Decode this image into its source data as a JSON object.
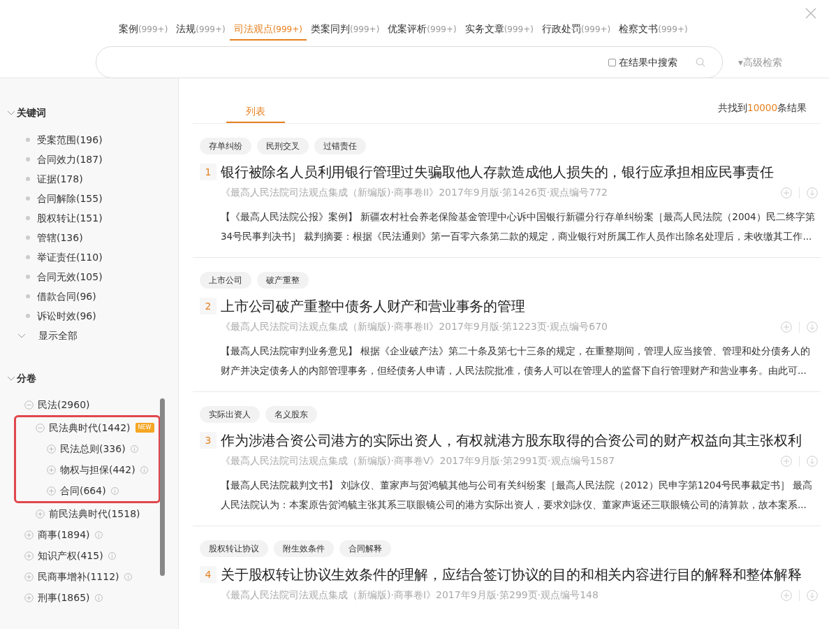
{
  "tabs": [
    {
      "label": "案例",
      "count": "(999+)",
      "selected": false
    },
    {
      "label": "法规",
      "count": "(999+)",
      "selected": false
    },
    {
      "label": "司法观点",
      "count": "(999+)",
      "selected": true
    },
    {
      "label": "类案同判",
      "count": "(999+)",
      "selected": false
    },
    {
      "label": "优案评析",
      "count": "(999+)",
      "selected": false
    },
    {
      "label": "实务文章",
      "count": "(999+)",
      "selected": false
    },
    {
      "label": "行政处罚",
      "count": "(999+)",
      "selected": false
    },
    {
      "label": "检察文书",
      "count": "(999+)",
      "selected": false
    }
  ],
  "search": {
    "in_results_label": "在结果中搜索",
    "in_results_checked": false,
    "advanced": "▾高级检索"
  },
  "sidebar": {
    "keywords": {
      "title": "关键词",
      "expanded": true,
      "items": [
        "受案范围(196)",
        "合同效力(187)",
        "证据(178)",
        "合同解除(155)",
        "股权转让(151)",
        "管辖(136)",
        "举证责任(110)",
        "合同无效(105)",
        "借款合同(96)",
        "诉讼时效(96)"
      ],
      "show_all": "显示全部"
    },
    "volumes": {
      "title": "分卷",
      "expanded": true,
      "tree": [
        {
          "label": "民法(2960)",
          "expanded": true,
          "info": false,
          "highlighted": false,
          "children": [
            {
              "label": "民法典时代(1442)",
              "expanded": true,
              "info": false,
              "badge": "NEW",
              "highlighted": true,
              "children": [
                {
                  "label": "民法总则(336)",
                  "expanded": false,
                  "info": true,
                  "highlighted": false
                },
                {
                  "label": "物权与担保(442)",
                  "expanded": false,
                  "info": true,
                  "highlighted": false
                },
                {
                  "label": "合同(664)",
                  "expanded": false,
                  "info": true,
                  "highlighted": false
                }
              ]
            },
            {
              "label": "前民法典时代(1518)",
              "expanded": false,
              "info": false,
              "highlighted": false
            }
          ]
        },
        {
          "label": "商事(1894)",
          "expanded": false,
          "info": true,
          "highlighted": false
        },
        {
          "label": "知识产权(415)",
          "expanded": false,
          "info": true,
          "highlighted": false
        },
        {
          "label": "民商事增补(1112)",
          "expanded": false,
          "info": true,
          "highlighted": false
        },
        {
          "label": "刑事(1865)",
          "expanded": false,
          "info": true,
          "highlighted": false
        }
      ]
    }
  },
  "view_tabs": [
    {
      "label": "列表",
      "selected": true
    }
  ],
  "result_count": {
    "prefix": "共找到",
    "count": "10000",
    "suffix": "条结果"
  },
  "results": [
    {
      "tags": [
        "存单纠纷",
        "民刑交叉",
        "过错责任"
      ],
      "number": "1",
      "title": "银行被除名人员利用银行管理过失骗取他人存款造成他人损失的，银行应承担相应民事责任",
      "source": "《最高人民法院司法观点集成（新编版)·商事卷II》2017年9月版·第1426页·观点编号772",
      "abstract": "【《最高人民法院公报》案例】 新疆农村社会养老保险基金管理中心诉中国银行新疆分行存单纠纷案［最高人民法院（2004）民二终字第34号民事判决书］ 裁判摘要：根据《民法通则》第一百零六条第二款的规定，商业银行对所属工作人员作出除名处理后，未收缴其工作..."
    },
    {
      "tags": [
        "上市公司",
        "破产重整"
      ],
      "number": "2",
      "title": "上市公司破产重整中债务人财产和营业事务的管理",
      "source": "《最高人民法院司法观点集成（新编版)·商事卷II》2017年9月版·第1223页·观点编号670",
      "abstract": "【最高人民法院审判业务意见】 根据《企业破产法》第二十条及第七十三条的规定，在重整期间，管理人应当接管、管理和处分债务人的财产并决定债务人的内部管理事务，但经债务人申请，人民法院批准，债务人可以在管理人的监督下自行管理财产和营业事务。由此可..."
    },
    {
      "tags": [
        "实际出资人",
        "名义股东"
      ],
      "number": "3",
      "title": "作为涉港合资公司港方的实际出资人，有权就港方股东取得的合资公司的财产权益向其主张权利",
      "source": "《最高人民法院司法观点集成（新编版)·商事卷V》2017年9月版·第2991页·观点编号1587",
      "abstract": "【最高人民法院裁判文书】 刘詠仪、董家声与贺鸿毓其他与公司有关纠纷案［最高人民法院（2012）民申字第1204号民事裁定书］ 最高人民法院认为：本案原告贺鸿毓主张其系三联眼镜公司的港方实际出资人，要求刘詠仪、董家声返还三联眼镜公司的清算款，故本案系..."
    },
    {
      "tags": [
        "股权转让协议",
        "附生效条件",
        "合同解释"
      ],
      "number": "4",
      "title": "关于股权转让协议生效条件的理解，应结合签订协议的目的和相关内容进行目的解释和整体解释",
      "source": "《最高人民法院司法观点集成（新编版)·商事卷I》2017年9月版·第299页·观点编号148"
    }
  ]
}
